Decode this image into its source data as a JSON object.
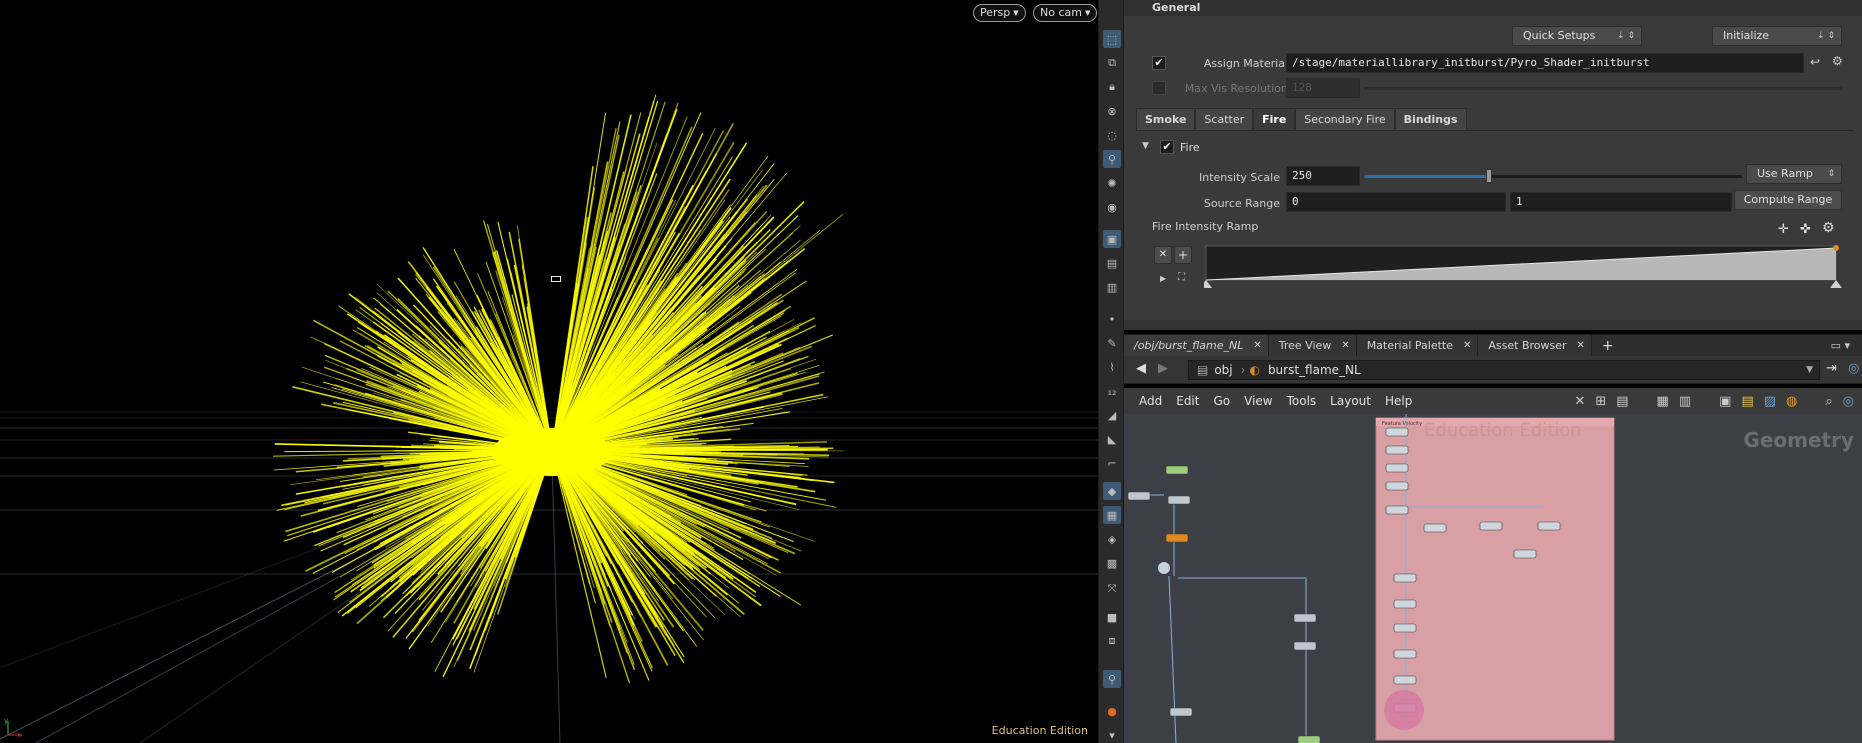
{
  "viewport": {
    "camera_menu": "Persp",
    "cam_menu": "No cam",
    "edition_label": "Education Edition",
    "flame_color": "#ffff00"
  },
  "params": {
    "section_title": "General",
    "quick_setups": "Quick Setups",
    "initialize": "Initialize",
    "assign_material_label": "Assign Material",
    "assign_material_value": "/stage/materiallibrary_initburst/Pyro_Shader_initburst",
    "max_vis_label": "Max Vis Resolution",
    "max_vis_value": "128",
    "tabs": [
      "Smoke",
      "Scatter",
      "Fire",
      "Secondary Fire",
      "Bindings"
    ],
    "fire_folder": "Fire",
    "intensity_label": "Intensity Scale",
    "intensity_value": "250",
    "intensity_fraction": 0.33,
    "use_ramp": "Use Ramp",
    "source_range_label": "Source Range",
    "source_range_min": "0",
    "source_range_max": "1",
    "compute_range": "Compute Range",
    "ramp_label": "Fire Intensity Ramp"
  },
  "pane_tabs": [
    "/obj/burst_flame_NL",
    "Tree View",
    "Material Palette",
    "Asset Browser"
  ],
  "path": {
    "root": "obj",
    "node": "burst_flame_NL"
  },
  "net_menu": [
    "Add",
    "Edit",
    "Go",
    "View",
    "Tools",
    "Layout",
    "Help"
  ],
  "network": {
    "edition_watermark": "Education Edition",
    "context_label": "Geometry",
    "network_box_title": "Feature Velocity"
  }
}
